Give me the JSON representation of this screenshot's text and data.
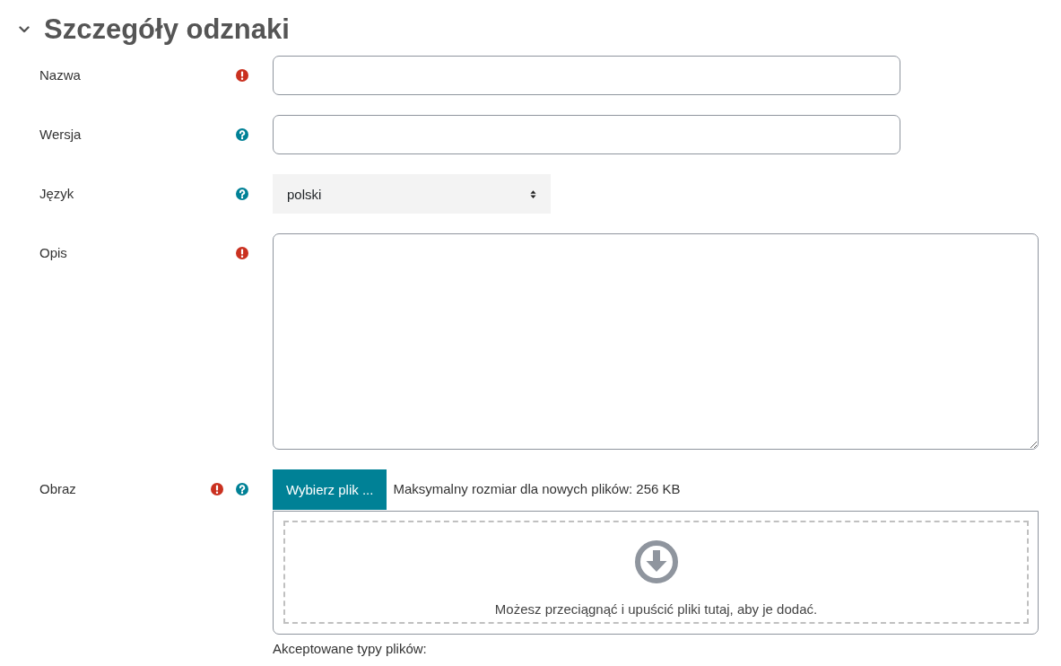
{
  "section": {
    "title": "Szczegóły odznaki",
    "expanded": true
  },
  "fields": [
    {
      "label": "Nazwa",
      "kind": "text",
      "required": true,
      "help": false
    },
    {
      "label": "Wersja",
      "kind": "text",
      "required": false,
      "help": true
    },
    {
      "label": "Język",
      "kind": "select",
      "required": false,
      "help": true,
      "value": "polski"
    },
    {
      "label": "Opis",
      "kind": "textarea",
      "required": true,
      "help": false
    },
    {
      "label": "Obraz",
      "kind": "filepicker",
      "required": true,
      "help": true,
      "button": "Wybierz plik ...",
      "max_size_note": "Maksymalny rozmiar dla nowych plików: 256 KB",
      "dropzone_text": "Możesz przeciągnąć i upuścić pliki tutaj, aby je dodać.",
      "accepted_types": "Akceptowane typy plików:"
    }
  ]
}
